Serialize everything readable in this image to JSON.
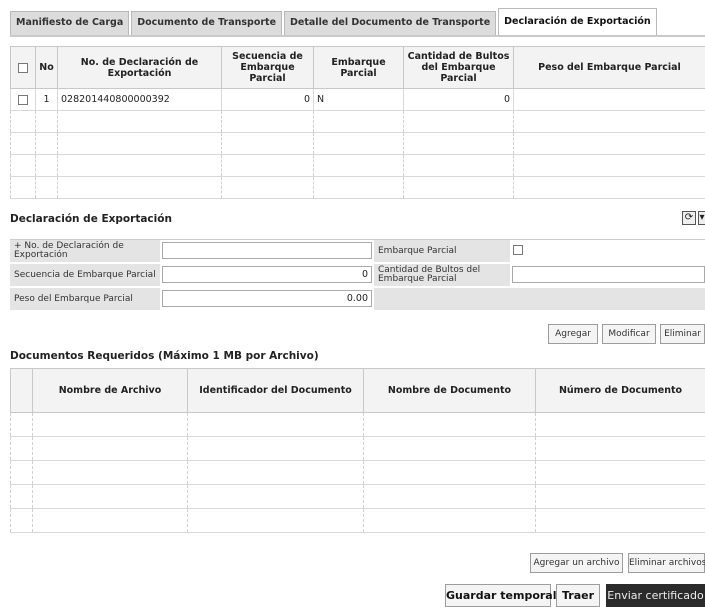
{
  "tabs": [
    {
      "label": "Manifiesto de Carga",
      "active": false
    },
    {
      "label": "Documento de Transporte",
      "active": false
    },
    {
      "label": "Detalle del Documento de Transporte",
      "active": false
    },
    {
      "label": "Declaración de Exportación",
      "active": true
    }
  ],
  "export_table": {
    "headers": {
      "no": "No",
      "declaration_no": "No. de Declaración de Exportación",
      "sequence": "Secuencia de Embarque Parcial",
      "partial": "Embarque Parcial",
      "packages": "Cantidad de Bultos del Embarque Parcial",
      "weight": "Peso del Embarque Parcial"
    },
    "row": {
      "no": "1",
      "declaration_no": "028201440800000392",
      "sequence": "0",
      "partial": "N",
      "packages": "0",
      "weight": ""
    }
  },
  "declaration_form": {
    "title": "Declaración de Exportación",
    "declaration_no_label": "+ No. de Declaración de Exportación",
    "declaration_no_value": "",
    "partial_label": "Embarque Parcial",
    "sequence_label": "Secuencia de Embarque Parcial",
    "sequence_value": "0",
    "packages_label": "Cantidad de Bultos del Embarque Parcial",
    "packages_value": "",
    "weight_label": "Peso del Embarque Parcial",
    "weight_value": "0.00"
  },
  "form_buttons": {
    "add": "Agregar",
    "modify": "Modificar",
    "delete": "Eliminar"
  },
  "documents": {
    "title": "Documentos Requeridos (Máximo 1 MB por Archivo)",
    "headers": {
      "file_name": "Nombre de Archivo",
      "doc_id": "Identificador del Documento",
      "doc_name": "Nombre de Documento",
      "doc_number": "Número de Documento"
    },
    "add_file": "Agregar un archivo",
    "delete_files": "Eliminar archivos"
  },
  "footer": {
    "save_temp": "Guardar temporal",
    "fetch": "Traer",
    "send": "Enviar certificado"
  }
}
